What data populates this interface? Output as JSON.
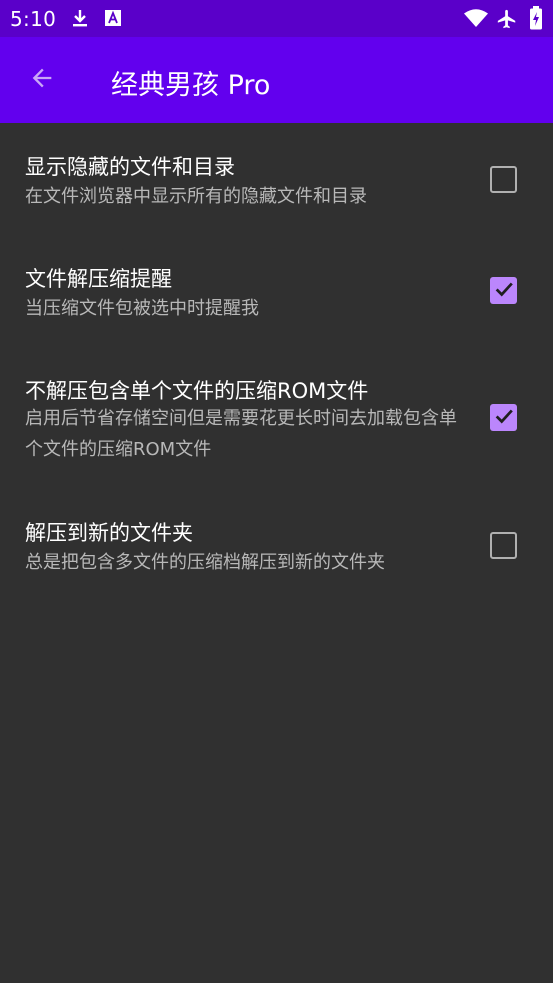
{
  "status_bar": {
    "time": "5:10",
    "icons": [
      "download-icon",
      "a-notification-icon",
      "wifi-icon",
      "airplane-icon",
      "battery-icon"
    ]
  },
  "app_bar": {
    "title": "经典男孩 Pro",
    "back_icon": "arrow-back-icon"
  },
  "colors": {
    "status_bar": "#5a00c9",
    "app_bar": "#6200ee",
    "background": "#303030",
    "accent": "#bb86fc",
    "primary_text": "#ffffff",
    "secondary_text": "#b8b8b8"
  },
  "preferences": [
    {
      "title": "显示隐藏的文件和目录",
      "summary": "在文件浏览器中显示所有的隐藏文件和目录",
      "checked": false
    },
    {
      "title": "文件解压缩提醒",
      "summary": "当压缩文件包被选中时提醒我",
      "checked": true
    },
    {
      "title": "不解压包含单个文件的压缩ROM文件",
      "summary": "启用后节省存储空间但是需要花更长时间去加载包含单个文件的压缩ROM文件",
      "checked": true
    },
    {
      "title": "解压到新的文件夹",
      "summary": "总是把包含多文件的压缩档解压到新的文件夹",
      "checked": false
    }
  ]
}
